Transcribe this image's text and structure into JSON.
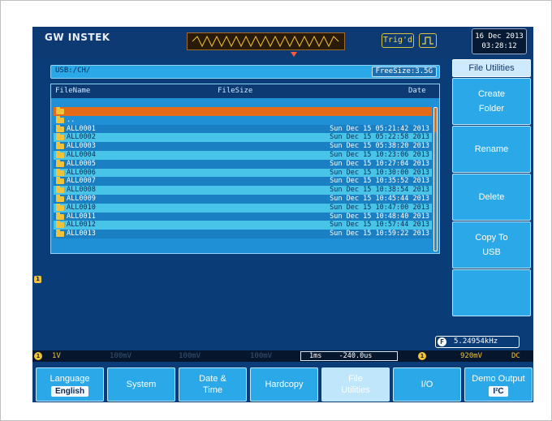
{
  "brand": "GW INSTEK",
  "status": {
    "trigger": "Trig'd",
    "date": "16 Dec 2013",
    "time": "03:28:12"
  },
  "path_bar": {
    "path": "USB:/CH/",
    "free_size": "FreeSize:3.5G"
  },
  "file_list": {
    "columns": [
      "FileName",
      "FileSize",
      "Date"
    ],
    "up_entry": "..",
    "rows": [
      {
        "name": "ALL0001",
        "date": "Sun Dec 15 05:21:42 2013"
      },
      {
        "name": "ALL0002",
        "date": "Sun Dec 15 05:22:58 2013"
      },
      {
        "name": "ALL0003",
        "date": "Sun Dec 15 05:38:20 2013"
      },
      {
        "name": "ALL0004",
        "date": "Sun Dec 15 10:23:06 2013"
      },
      {
        "name": "ALL0005",
        "date": "Sun Dec 15 10:27:04 2013"
      },
      {
        "name": "ALL0006",
        "date": "Sun Dec 15 10:30:00 2013"
      },
      {
        "name": "ALL0007",
        "date": "Sun Dec 15 10:35:52 2013"
      },
      {
        "name": "ALL0008",
        "date": "Sun Dec 15 10:38:54 2013"
      },
      {
        "name": "ALL0009",
        "date": "Sun Dec 15 10:45:44 2013"
      },
      {
        "name": "ALL0010",
        "date": "Sun Dec 15 10:47:00 2013"
      },
      {
        "name": "ALL0011",
        "date": "Sun Dec 15 10:48:40 2013"
      },
      {
        "name": "ALL0012",
        "date": "Sun Dec 15 10:57:44 2013"
      },
      {
        "name": "ALL0013",
        "date": "Sun Dec 15 10:59:22 2013"
      }
    ]
  },
  "side_menu": {
    "title": "File Utilities",
    "buttons": [
      "Create Folder",
      "Rename",
      "Delete",
      "Copy To USB",
      ""
    ]
  },
  "readouts": {
    "frequency_label": "F",
    "frequency": "5.24954kHz",
    "ch1_number": "1",
    "ch1_scale": "1V",
    "ghost_ch2": "100mV",
    "ghost_ch3": "100mV",
    "ghost_ch4": "100mV",
    "timebase": "1ms",
    "horizontal_position": "-240.0us",
    "trigger_source": "1",
    "trigger_level": "920mV",
    "coupling": "DC"
  },
  "bottom_menu": [
    {
      "label": "Language",
      "value": "English"
    },
    {
      "label": "System"
    },
    {
      "label": "Date & Time"
    },
    {
      "label": "Hardcopy"
    },
    {
      "label": "File Utilities"
    },
    {
      "label": "I/O"
    },
    {
      "label": "Demo Output",
      "value": "I²C"
    }
  ],
  "colors": {
    "screen_bg": "#0a3c78",
    "accent_blue": "#2aa8e8",
    "selection": "#e46a1a",
    "channel1": "#f2c23a"
  }
}
